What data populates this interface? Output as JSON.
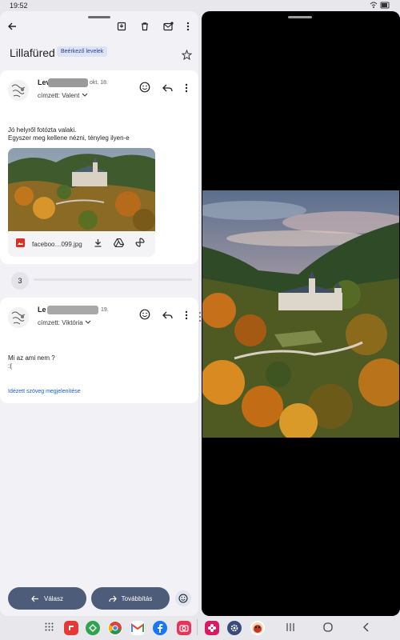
{
  "status": {
    "time": "19:52",
    "icons": "wifi battery"
  },
  "toolbar": {
    "back": "←",
    "archive": "⬒",
    "delete": "🗑",
    "mark": "✉",
    "more": "⋮"
  },
  "thread": {
    "subject": "Lillafüred",
    "label": "Beérkező levelek",
    "collapsed_count": "3"
  },
  "message1": {
    "sender": "Lev",
    "date": "okt. 18.",
    "to": "címzett: Valent",
    "body_line1": "Jó helyről fotózta valaki.",
    "body_line2": "Egyszer meg kellene nézni, tényleg ilyen-e",
    "attachment_name": "faceboo…099.jpg"
  },
  "message2": {
    "sender": "Le",
    "date": "19.",
    "to": "címzett: Viktória",
    "body_line1": "Mi az ami nem ?",
    "body_line2": ":(",
    "quoted_link": "Idézett szöveg megjelenítése"
  },
  "actions": {
    "reply": "Válasz",
    "forward": "Továbbítás"
  },
  "colors": {
    "accent": "#4d5c79",
    "link": "#1a5fd1",
    "chip": "#dde3f7"
  }
}
